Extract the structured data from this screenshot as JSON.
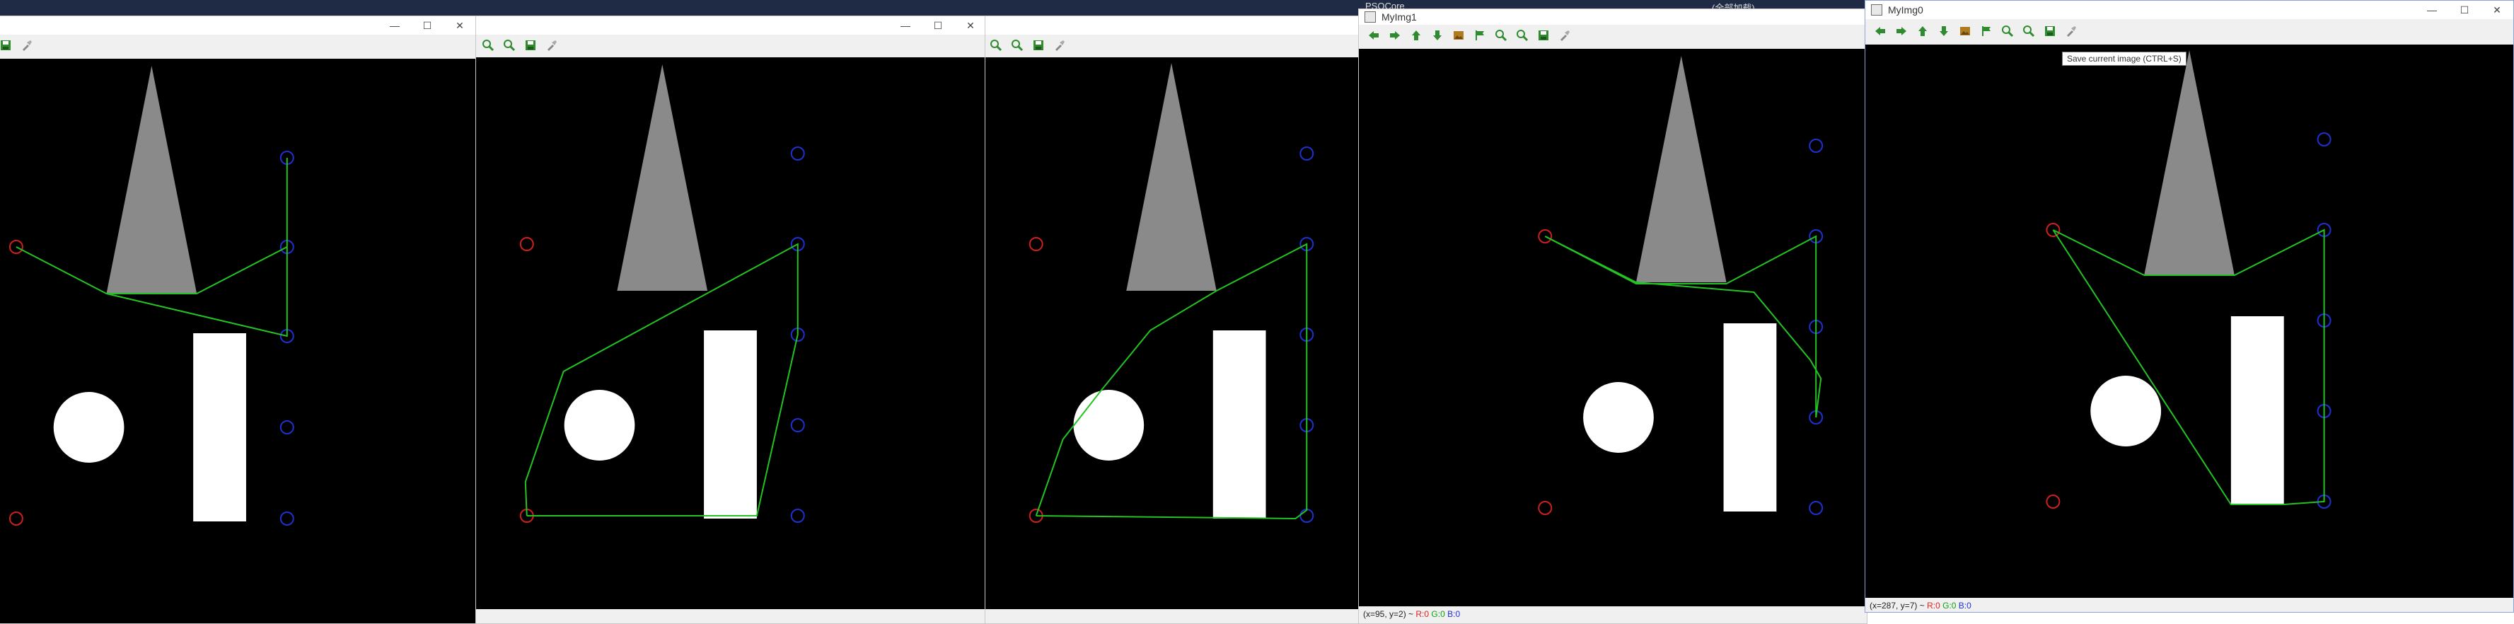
{
  "windows": {
    "w0": {
      "title": ""
    },
    "w1": {
      "title": ""
    },
    "w2": {
      "title": ""
    },
    "w3": {
      "title": "MyImg1",
      "status": {
        "coords": "(x=95, y=2) ~",
        "r": "R:0",
        "g": "G:0",
        "b": "B:0"
      }
    },
    "w4": {
      "title": "MyImg0",
      "status": {
        "coords": "(x=287, y=7) ~",
        "r": "R:0",
        "g": "G:0",
        "b": "B:0"
      }
    }
  },
  "background": {
    "title_left": "PSOCore",
    "title_right": "(全部加载)"
  },
  "window_controls": {
    "minimize": "—",
    "maximize": "☐",
    "close": "✕"
  },
  "toolbar_icons": [
    "arrow-left-icon",
    "arrow-right-icon",
    "arrow-up-icon",
    "arrow-down-icon",
    "image-icon",
    "flag-icon",
    "zoom-in-icon",
    "zoom-out-icon",
    "save-icon",
    "properties-icon"
  ],
  "tooltip": {
    "text": "Save current image (CTRL+S)"
  },
  "colors": {
    "path": "#22c322",
    "start_marker": "#cc2020",
    "goal_marker": "#2030cc",
    "triangle": "#8a8a8a",
    "obstacle": "#ffffff"
  }
}
